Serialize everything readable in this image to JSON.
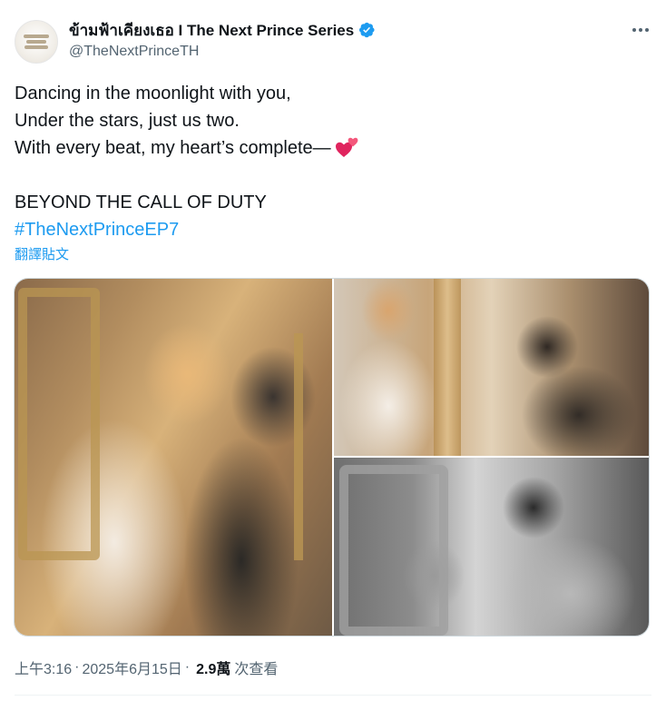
{
  "account": {
    "display_name": "ข้ามฟ้าเคียงเธอ I The Next Prince Series",
    "handle": "@TheNextPrinceTH",
    "verified": true,
    "verified_color": "#1d9bf0"
  },
  "tweet": {
    "lines": [
      "Dancing in the moonlight with you,",
      "Under the stars, just us two.",
      "With every beat, my heart’s complete—"
    ],
    "emoji": "two-hearts-icon",
    "headline": "BEYOND THE CALL OF DUTY",
    "hashtag": "#TheNextPrinceEP7",
    "translate_label": "翻譯貼文"
  },
  "media": {
    "photos": [
      "photo-1",
      "photo-2",
      "photo-3"
    ]
  },
  "footer": {
    "time": "上午3:16",
    "separator": "·",
    "date": "2025年6月15日",
    "views_count": "2.9萬",
    "views_label": "次查看"
  },
  "colors": {
    "link": "#1d9bf0",
    "secondary_text": "#536471",
    "primary_text": "#0f1419"
  }
}
